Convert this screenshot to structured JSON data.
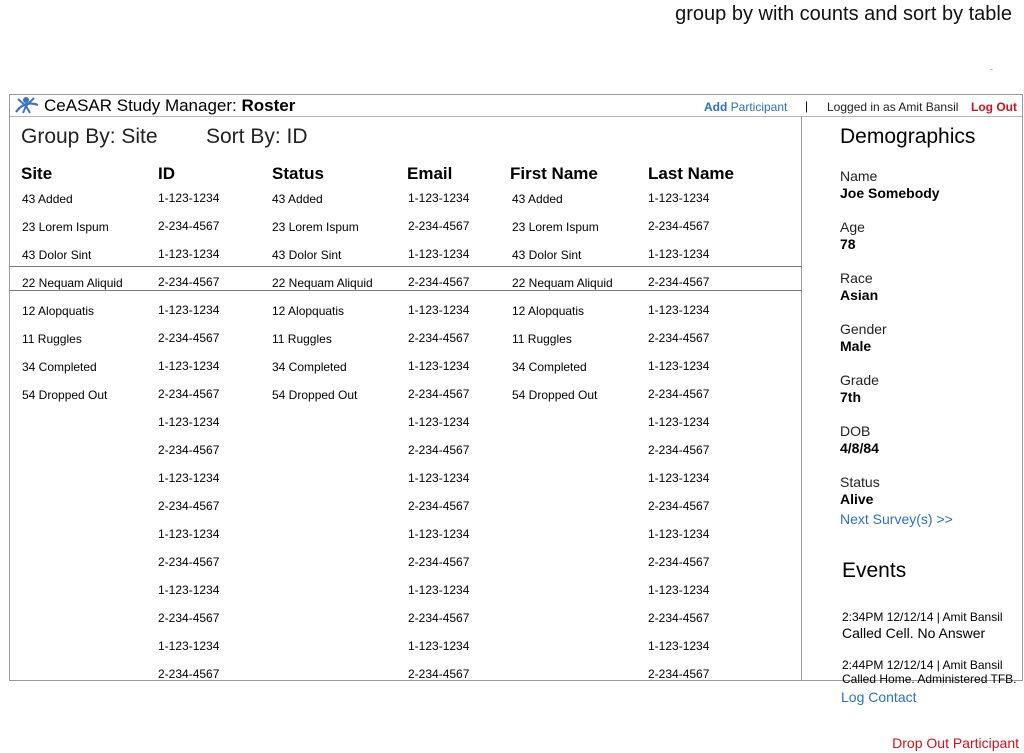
{
  "annotation": {
    "caption": "group by with counts and sort by table",
    "mark": "-"
  },
  "header": {
    "app_name": "CeASAR Study Manager: ",
    "page_name": "Roster",
    "add_bold": "Add",
    "add_rest": " Participant",
    "separator": "|",
    "logged_in": "Logged in as Amit Bansil",
    "logout": "Log Out"
  },
  "toolbar": {
    "group_by": "Group By: Site",
    "sort_by": "Sort By: ID"
  },
  "table": {
    "columns": [
      "Site",
      "ID",
      "Status",
      "Email",
      "First Name",
      "Last Name"
    ],
    "groups": [
      "43 Added",
      "23 Lorem Ispum",
      "43 Dolor Sint",
      "22 Nequam Aliquid",
      "12 Alopquatis",
      "11 Ruggles",
      "34 Completed",
      "54 Dropped Out"
    ],
    "ids": [
      "1-123-1234",
      "2-234-4567",
      "1-123-1234",
      "2-234-4567",
      "1-123-1234",
      "2-234-4567",
      "1-123-1234",
      "2-234-4567",
      "1-123-1234",
      "2-234-4567",
      "1-123-1234",
      "2-234-4567",
      "1-123-1234",
      "2-234-4567",
      "1-123-1234",
      "2-234-4567",
      "1-123-1234",
      "2-234-4567"
    ]
  },
  "demographics": {
    "title": "Demographics",
    "fields": [
      {
        "label": "Name",
        "value": "Joe Somebody"
      },
      {
        "label": "Age",
        "value": "78"
      },
      {
        "label": "Race",
        "value": "Asian"
      },
      {
        "label": "Gender",
        "value": "Male"
      },
      {
        "label": "Grade",
        "value": "7th"
      },
      {
        "label": "DOB",
        "value": "4/8/84"
      },
      {
        "label": "Status",
        "value": "Alive"
      }
    ],
    "next_survey": "Next Survey(s) >>"
  },
  "events": {
    "title": "Events",
    "items": [
      {
        "meta": "2:34PM 12/12/14  |  Amit Bansil",
        "note": "Called Cell. No Answer"
      },
      {
        "meta": "2:44PM 12/12/14  |  Amit Bansil",
        "note": "Called Home. Administered TFB."
      }
    ],
    "log_contact": "Log Contact"
  },
  "footer": {
    "drop_out": "Drop Out Participant"
  }
}
